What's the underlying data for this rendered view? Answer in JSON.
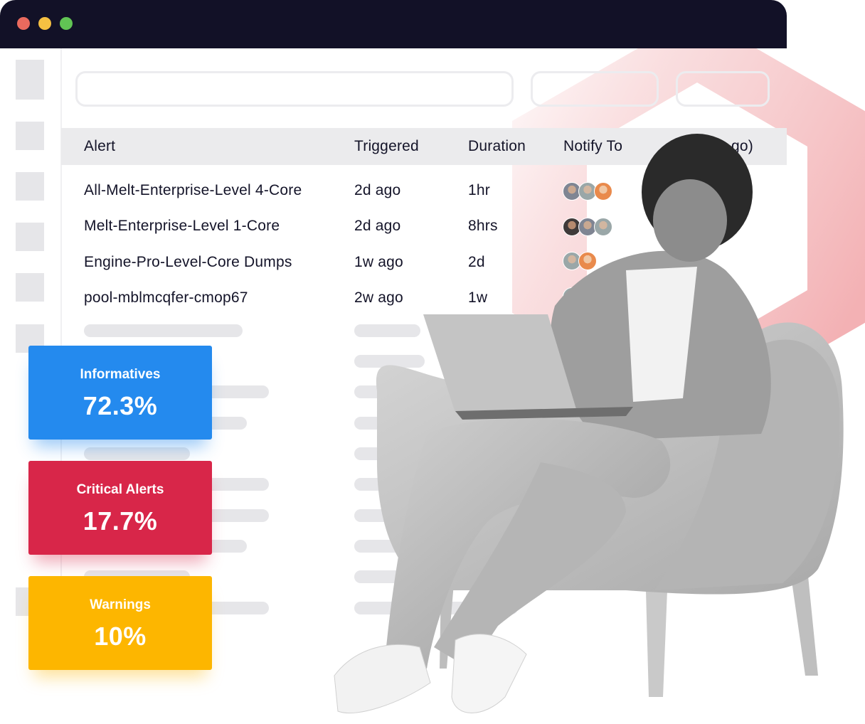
{
  "window": {
    "controls": [
      {
        "name": "close",
        "color": "#ea6a5e"
      },
      {
        "name": "minimize",
        "color": "#f5c042"
      },
      {
        "name": "maximize",
        "color": "#61c454"
      }
    ]
  },
  "table": {
    "headers": [
      "Alert",
      "Triggered",
      "Duration",
      "Notify To",
      "go)"
    ],
    "rows": [
      {
        "alert": "All-Melt-Enterprise-Level 4-Core",
        "triggered": "2d ago",
        "duration": "1hr",
        "notify_count": 3
      },
      {
        "alert": "Melt-Enterprise-Level 1-Core",
        "triggered": "2d ago",
        "duration": "8hrs",
        "notify_count": 3
      },
      {
        "alert": "Engine-Pro-Level-Core Dumps",
        "triggered": "1w ago",
        "duration": "2d",
        "notify_count": 2
      },
      {
        "alert": "pool-mblmcqfer-cmop67",
        "triggered": "2w ago",
        "duration": "1w",
        "notify_count": 2
      }
    ]
  },
  "stats": [
    {
      "label": "Informatives",
      "value": "72.3%",
      "color": "#248aee"
    },
    {
      "label": "Critical Alerts",
      "value": "17.7%",
      "color": "#d82649"
    },
    {
      "label": "Warnings",
      "value": "10%",
      "color": "#fdb600"
    }
  ],
  "colors": {
    "titlebar": "#121127",
    "accent_hexagon": "#f3b3b6",
    "skeleton": "#e6e6e9",
    "table_header": "#ebebed"
  }
}
